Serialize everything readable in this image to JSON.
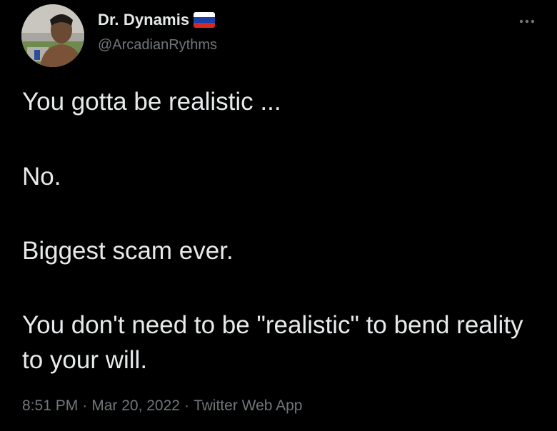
{
  "author": {
    "display_name": "Dr. Dynamis",
    "handle": "@ArcadianRythms",
    "flag_icon": "russian-flag-icon",
    "flag_colors": [
      "#ffffff",
      "#1c3fa8",
      "#d52b1e"
    ]
  },
  "tweet": {
    "paragraphs": [
      "You gotta be realistic ...",
      "No.",
      "Biggest scam ever.",
      "You don't need to be \"realistic\" to bend reality to your will."
    ]
  },
  "meta": {
    "time": "8:51 PM",
    "separator": "·",
    "date": "Mar 20, 2022",
    "source": "Twitter Web App"
  },
  "menu_icon": "more-horizontal-icon",
  "colors": {
    "background": "#000000",
    "primary_text": "#e7e9ea",
    "secondary_text": "#71767b"
  }
}
